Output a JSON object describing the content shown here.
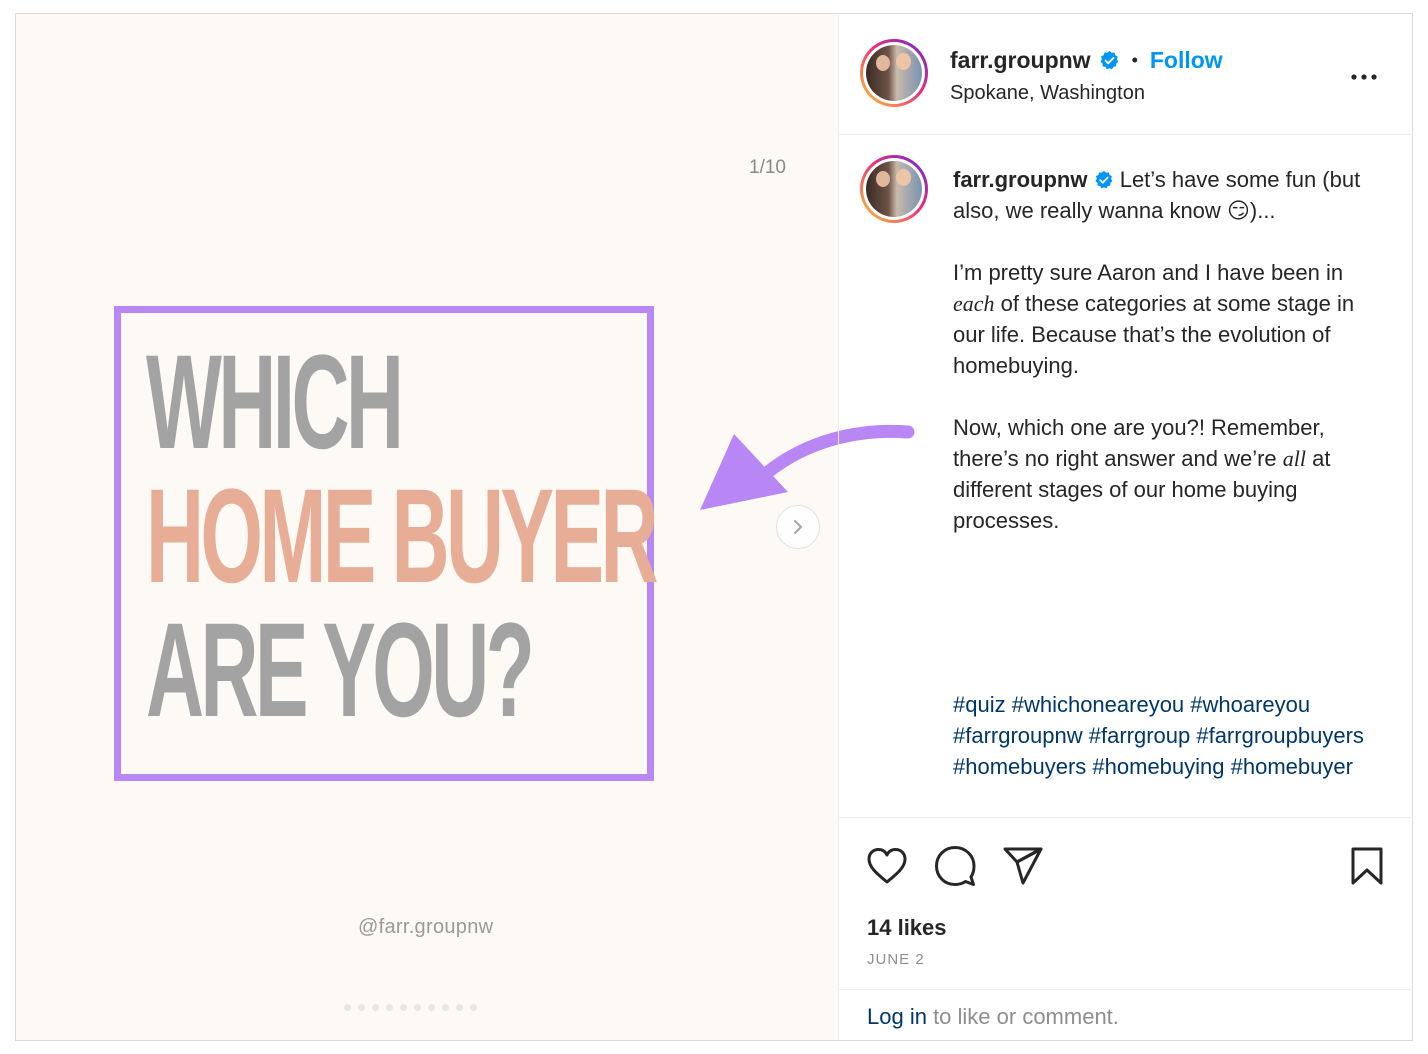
{
  "media": {
    "counter": "1/10",
    "headline": {
      "line1": "WHICH",
      "line2": "HOME BUYER",
      "line3": "ARE YOU?"
    },
    "watermark": "@farr.groupnw",
    "next_icon": "chevron-right-icon",
    "colors": {
      "accent_box": "#b886f5",
      "headline_gray": "#a3a3a3",
      "headline_peach": "#e7ad97"
    }
  },
  "header": {
    "username": "farr.groupnw",
    "separator": "•",
    "follow_label": "Follow",
    "location": "Spokane, Washington",
    "more_icon": "more-horizontal-icon"
  },
  "caption": {
    "username": "farr.groupnw",
    "line1": "Let’s have some fun (but also, we really wanna know",
    "emoji": "😏",
    "line1_end": ")...",
    "para2_a": "I’m pretty sure Aaron and I have been in",
    "para2_em": "each",
    "para2_b": "of these categories at some stage in our life. Because that’s the evolution of homebuying.",
    "para3_a": "Now, which one are you?! Remember, there’s no right answer and we’re",
    "para3_em": "all",
    "para3_b": "at different stages of our home buying processes.",
    "hashtags": "#quiz #whichoneareyou #whoareyou #farrgroupnw #farrgroup #farrgroupbuyers #homebuyers #homebuying #homebuyer"
  },
  "actions": {
    "like_icon": "heart-icon",
    "comment_icon": "comment-icon",
    "share_icon": "send-icon",
    "save_icon": "bookmark-icon",
    "likes": "14 likes",
    "date": "JUNE 2"
  },
  "login": {
    "link": "Log in",
    "text": " to like or comment."
  },
  "colors": {
    "follow": "#0095f6",
    "hashtag": "#00376b",
    "verified": "#0095f6"
  }
}
